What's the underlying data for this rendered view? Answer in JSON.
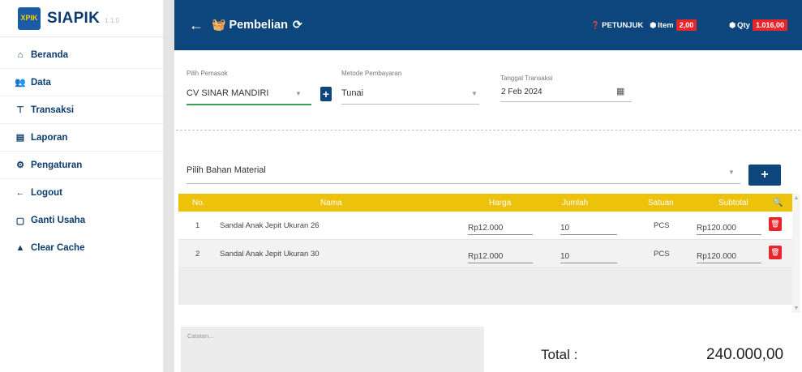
{
  "brand": {
    "logo_text": "XPIK",
    "name": "SIAPIK",
    "version": "1.1.0"
  },
  "sidebar": {
    "items": [
      {
        "label": "Beranda",
        "icon": "store-icon"
      },
      {
        "label": "Data",
        "icon": "people-icon"
      },
      {
        "label": "Transaksi",
        "icon": "cart-icon"
      },
      {
        "label": "Laporan",
        "icon": "report-icon"
      },
      {
        "label": "Pengaturan",
        "icon": "gears-icon"
      },
      {
        "label": "Logout",
        "icon": "arrow-left-icon"
      },
      {
        "label": "Ganti Usaha",
        "icon": "swap-icon"
      },
      {
        "label": "Clear Cache",
        "icon": "flask-icon"
      }
    ]
  },
  "header": {
    "title": "Pembelian",
    "petunjuk": "PETUNJUK",
    "item_label": "Item",
    "item_count": "2,00",
    "qty_label": "Qty",
    "qty_value": "1.016,00"
  },
  "form": {
    "supplier_label": "Pilih Pemasok",
    "supplier_value": "CV SINAR MANDIRI",
    "payment_label": "Metode Pembayaran",
    "payment_value": "Tunai",
    "date_label": "Tanggal Transaksi",
    "date_value": "2 Feb 2024",
    "material_placeholder": "Pilih Bahan Material"
  },
  "table": {
    "columns": [
      "No.",
      "Nama",
      "Harga",
      "Jumlah",
      "Satuan",
      "Subtotal"
    ],
    "rows": [
      {
        "no": "1",
        "nama": "Sandal Anak Jepit Ukuran 26",
        "harga": "Rp12.000",
        "jumlah": "10",
        "satuan": "PCS",
        "subtotal": "Rp120.000"
      },
      {
        "no": "2",
        "nama": "Sandal Anak Jepit Ukuran 30",
        "harga": "Rp12.000",
        "jumlah": "10",
        "satuan": "PCS",
        "subtotal": "Rp120.000"
      }
    ]
  },
  "footer": {
    "notes_placeholder": "Catatan...",
    "total_label": "Total :",
    "total_value": "240.000,00"
  },
  "colors": {
    "primary": "#0c467c",
    "table_header": "#edc20a",
    "danger": "#e8252a"
  }
}
